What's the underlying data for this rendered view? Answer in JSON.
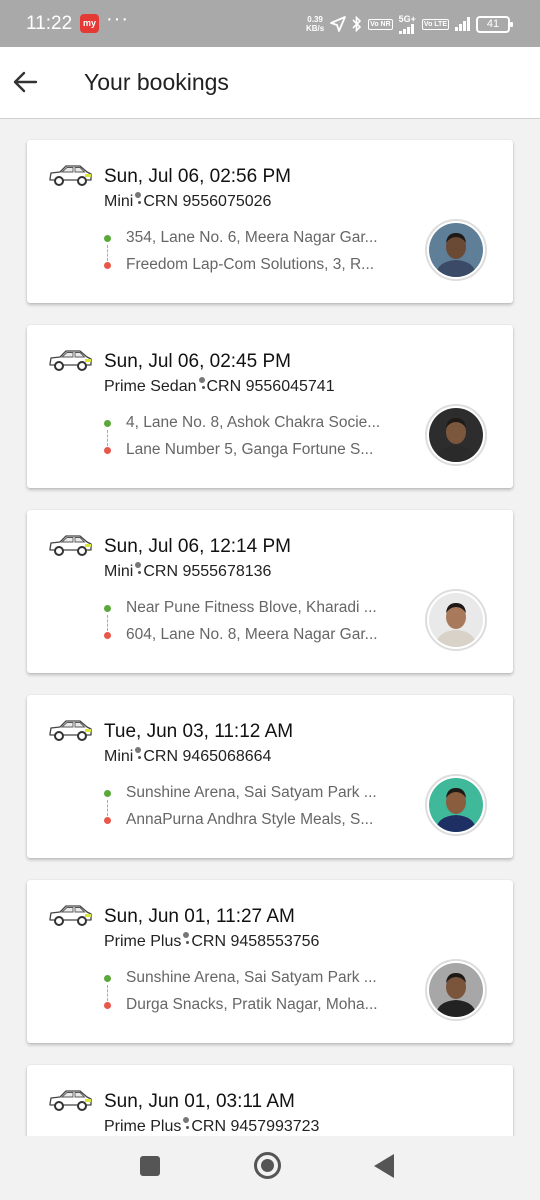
{
  "status_bar": {
    "time": "11:22",
    "app_badge": "my",
    "more": "···",
    "speed_value": "0.39",
    "speed_unit": "KB/s",
    "network": "5G+",
    "tag_volte": "Vo NR",
    "tag_lte": "Vo LTE",
    "battery": "41"
  },
  "header": {
    "title": "Your bookings",
    "back_icon": "arrow-left-icon"
  },
  "bookings": [
    {
      "datetime": "Sun, Jul 06, 02:56 PM",
      "category": "Mini",
      "crn": "CRN 9556075026",
      "pickup": "354, Lane No. 6, Meera Nagar Gar...",
      "drop": "Freedom Lap-Com Solutions, 3, R...",
      "avatar_bg": "#5f7f99",
      "avatar_shirt": "#3b4a66",
      "avatar_skin": "#6a4a34"
    },
    {
      "datetime": "Sun, Jul 06, 02:45 PM",
      "category": "Prime Sedan",
      "crn": "CRN 9556045741",
      "pickup": "4, Lane No. 8, Ashok Chakra Socie...",
      "drop": "Lane Number 5, Ganga Fortune S...",
      "avatar_bg": "#2d2d2d",
      "avatar_shirt": "#2a2a2a",
      "avatar_skin": "#7b573e"
    },
    {
      "datetime": "Sun, Jul 06, 12:14 PM",
      "category": "Mini",
      "crn": "CRN 9555678136",
      "pickup": "Near Pune Fitness Blove, Kharadi ...",
      "drop": "604, Lane No. 8, Meera Nagar Gar...",
      "avatar_bg": "#e9e9e9",
      "avatar_shirt": "#d8d2c8",
      "avatar_skin": "#a8795a"
    },
    {
      "datetime": "Tue, Jun 03, 11:12 AM",
      "category": "Mini",
      "crn": "CRN 9465068664",
      "pickup": "Sunshine Arena, Sai Satyam Park ...",
      "drop": "AnnaPurna Andhra Style Meals, S...",
      "avatar_bg": "#40b89a",
      "avatar_shirt": "#1e2f63",
      "avatar_skin": "#8a5d3f"
    },
    {
      "datetime": "Sun, Jun 01, 11:27 AM",
      "category": "Prime Plus",
      "crn": "CRN 9458553756",
      "pickup": "Sunshine Arena, Sai Satyam Park ...",
      "drop": "Durga Snacks, Pratik Nagar, Moha...",
      "avatar_bg": "#a7a7a7",
      "avatar_shirt": "#222222",
      "avatar_skin": "#7a553c"
    },
    {
      "datetime": "Sun, Jun 01, 03:11 AM",
      "category": "Prime Plus",
      "crn": "CRN 9457993723",
      "pickup": "",
      "drop": "",
      "avatar_bg": "#aaaaaa",
      "avatar_shirt": "#333333",
      "avatar_skin": "#7a553c"
    }
  ],
  "nav": {
    "recents_icon": "square-icon",
    "home_icon": "circle-icon",
    "back_icon": "triangle-icon"
  }
}
